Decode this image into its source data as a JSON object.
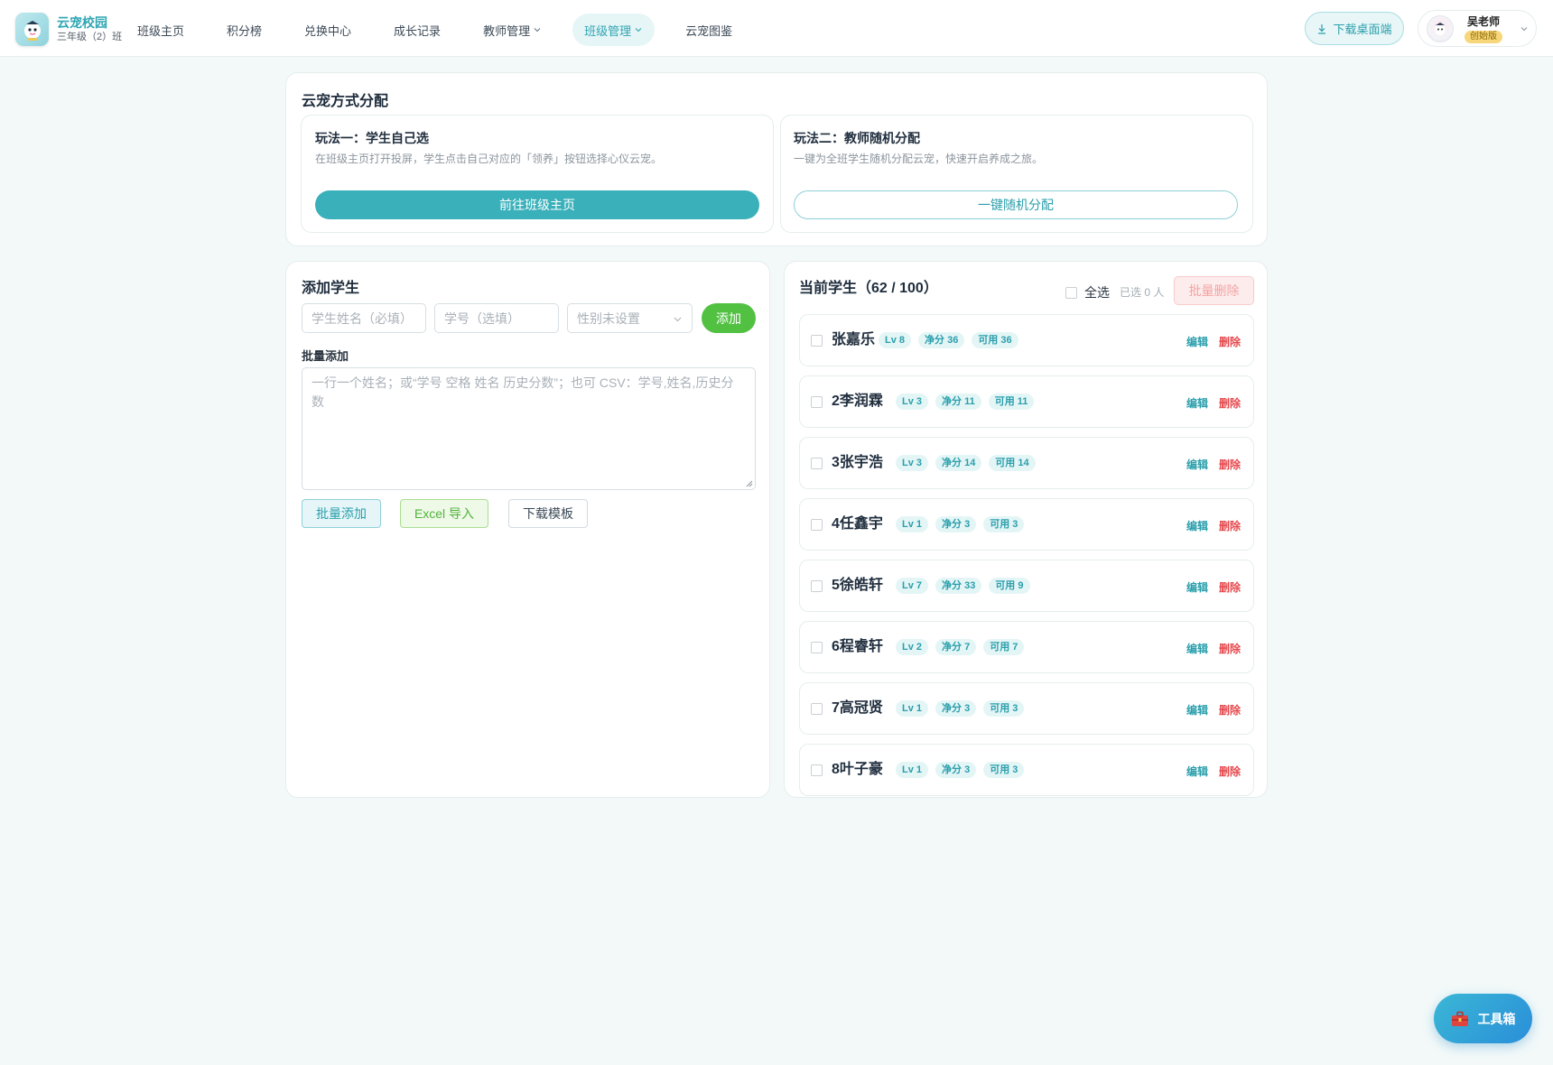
{
  "brand": {
    "name": "云宠校园",
    "class_name": "三年级（2）班"
  },
  "nav": [
    {
      "label": "班级主页",
      "dropdown": false,
      "active": false
    },
    {
      "label": "积分榜",
      "dropdown": false,
      "active": false
    },
    {
      "label": "兑换中心",
      "dropdown": false,
      "active": false
    },
    {
      "label": "成长记录",
      "dropdown": false,
      "active": false
    },
    {
      "label": "教师管理",
      "dropdown": true,
      "active": false
    },
    {
      "label": "班级管理",
      "dropdown": true,
      "active": true
    },
    {
      "label": "云宠图鉴",
      "dropdown": false,
      "active": false
    }
  ],
  "header": {
    "download_label": "下载桌面端",
    "user_name": "吴老师",
    "user_badge": "创始版"
  },
  "distribution": {
    "title": "云宠方式分配",
    "option1": {
      "title": "玩法一：学生自己选",
      "desc": "在班级主页打开投屏，学生点击自己对应的「领养」按钮选择心仪云宠。",
      "button": "前往班级主页"
    },
    "option2": {
      "title": "玩法二：教师随机分配",
      "desc": "一键为全班学生随机分配云宠，快速开启养成之旅。",
      "button": "一键随机分配"
    }
  },
  "add_student": {
    "title": "添加学生",
    "name_placeholder": "学生姓名（必填）",
    "id_placeholder": "学号（选填）",
    "gender_placeholder": "性别未设置",
    "add_button": "添加",
    "batch_label": "批量添加",
    "batch_placeholder": "一行一个姓名；或“学号 空格 姓名 历史分数”；也可 CSV：学号,姓名,历史分数",
    "batch_button": "批量添加",
    "excel_button": "Excel 导入",
    "template_button": "下载模板"
  },
  "student_list": {
    "title": "当前学生（62 / 100）",
    "select_all": "全选",
    "selected_count": "已选 0 人",
    "batch_delete": "批量删除",
    "edit_label": "编辑",
    "delete_label": "删除",
    "students": [
      {
        "name": "张嘉乐",
        "level": "Lv 8",
        "net": "净分 36",
        "available": "可用 36"
      },
      {
        "name": "2李润霖",
        "level": "Lv 3",
        "net": "净分 11",
        "available": "可用 11"
      },
      {
        "name": "3张宇浩",
        "level": "Lv 3",
        "net": "净分 14",
        "available": "可用 14"
      },
      {
        "name": "4任鑫宇",
        "level": "Lv 1",
        "net": "净分 3",
        "available": "可用 3"
      },
      {
        "name": "5徐皓轩",
        "level": "Lv 7",
        "net": "净分 33",
        "available": "可用 9"
      },
      {
        "name": "6程睿轩",
        "level": "Lv 2",
        "net": "净分 7",
        "available": "可用 7"
      },
      {
        "name": "7高冠贤",
        "level": "Lv 1",
        "net": "净分 3",
        "available": "可用 3"
      },
      {
        "name": "8叶子豪",
        "level": "Lv 1",
        "net": "净分 3",
        "available": "可用 3"
      }
    ]
  },
  "toolbox": {
    "label": "工具箱"
  },
  "colors": {
    "accent": "#3ab0ba",
    "success": "#52c142",
    "danger": "#e5484d"
  }
}
